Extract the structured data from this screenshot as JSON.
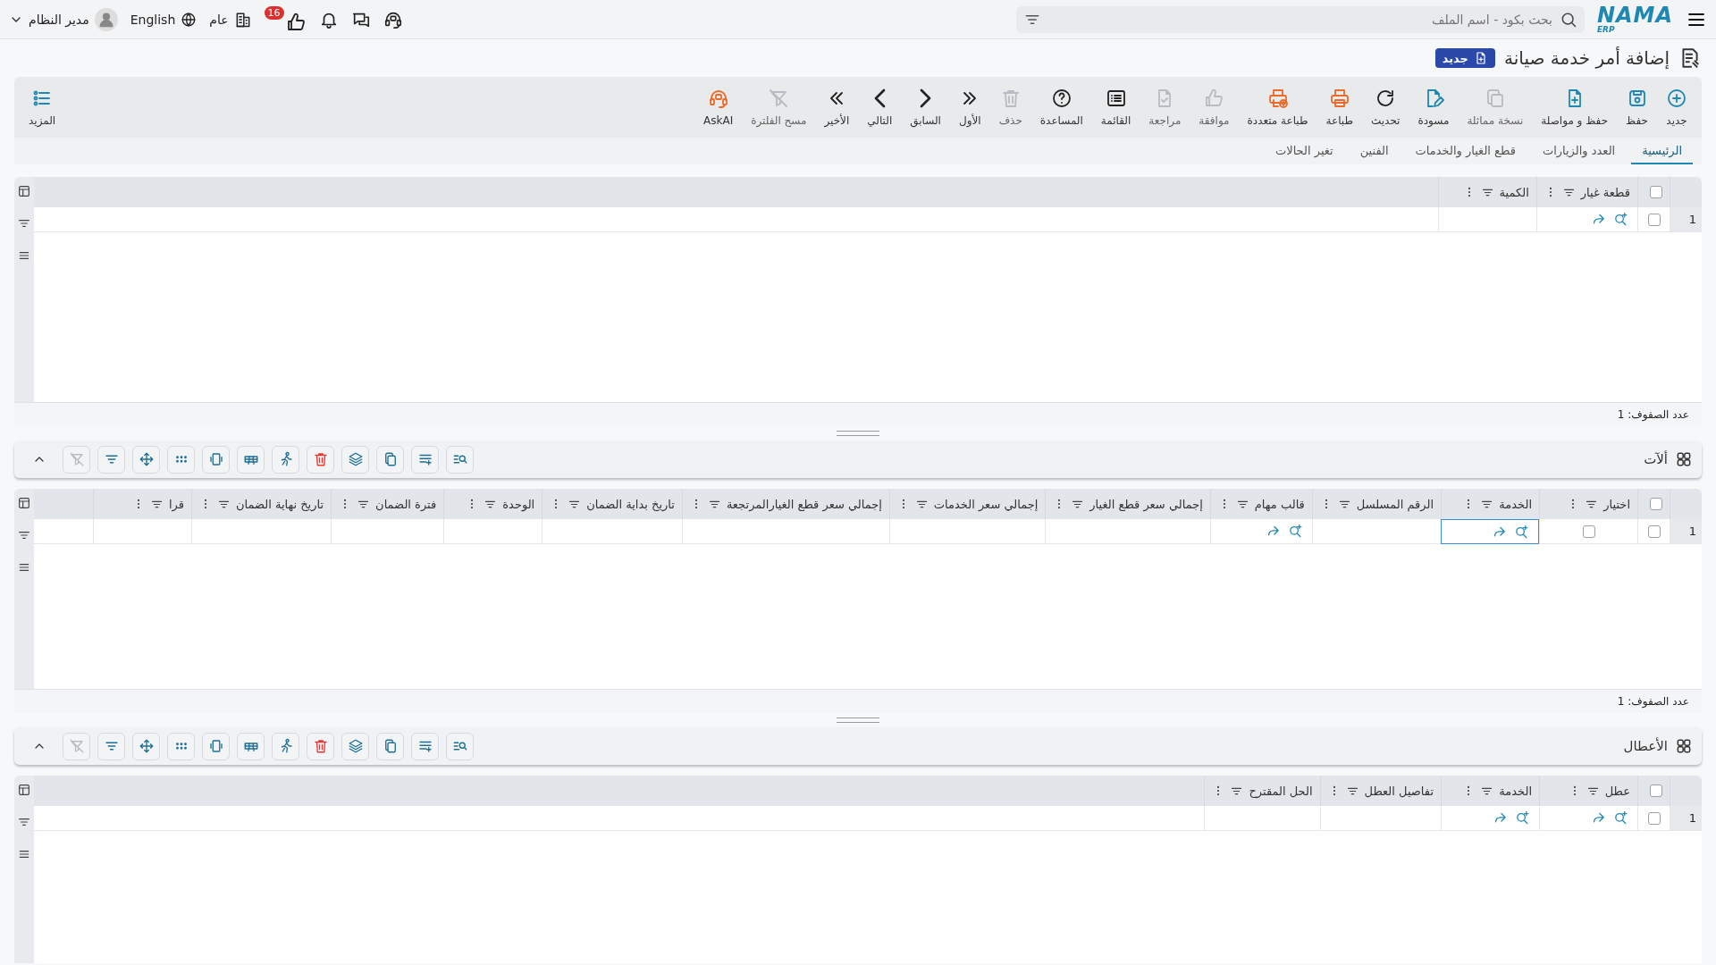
{
  "topbar": {
    "logo": "NAMA",
    "logo_sub": "ERP",
    "search": {
      "placeholder": "بحث بكود - اسم الملف"
    },
    "notifications_badge": "16",
    "branch": "عام",
    "language": "English",
    "user": "مدير النظام"
  },
  "page": {
    "title": "إضافة أمر خدمة صيانة",
    "status": "جديد"
  },
  "toolbar": {
    "buttons": [
      {
        "kind": "new",
        "label": "جديد",
        "disabled": false
      },
      {
        "kind": "save",
        "label": "حفظ",
        "disabled": false
      },
      {
        "kind": "save_continue",
        "label": "حفظ و مواصلة",
        "disabled": false
      },
      {
        "kind": "duplicate",
        "label": "نسخة مماثلة",
        "disabled": true
      },
      {
        "kind": "draft",
        "label": "مسودة",
        "disabled": false
      },
      {
        "kind": "refresh",
        "label": "تحديث",
        "disabled": false
      },
      {
        "kind": "print",
        "label": "طباعة",
        "disabled": false
      },
      {
        "kind": "print_multi",
        "label": "طباعة متعددة",
        "disabled": false
      },
      {
        "kind": "approve",
        "label": "موافقة",
        "disabled": true
      },
      {
        "kind": "review",
        "label": "مراجعة",
        "disabled": true
      },
      {
        "kind": "list",
        "label": "القائمة",
        "disabled": false
      },
      {
        "kind": "help",
        "label": "المساعدة",
        "disabled": false
      },
      {
        "kind": "delete",
        "label": "حذف",
        "disabled": true
      },
      {
        "kind": "first",
        "label": "الأول",
        "disabled": false
      },
      {
        "kind": "prev",
        "label": "السابق",
        "disabled": false
      },
      {
        "kind": "next",
        "label": "التالي",
        "disabled": false
      },
      {
        "kind": "last",
        "label": "الأخير",
        "disabled": false
      },
      {
        "kind": "clear_filter",
        "label": "مسح الفلترة",
        "disabled": true
      },
      {
        "kind": "ask_ai",
        "label": "AskAI",
        "disabled": false
      }
    ],
    "more": {
      "label": "المزيد"
    }
  },
  "tabs": [
    {
      "label": "الرئيسية",
      "selected": true
    },
    {
      "label": "العدد والزيارات",
      "selected": false
    },
    {
      "label": "قطع الغيار والخدمات",
      "selected": false
    },
    {
      "label": "الفنين",
      "selected": false
    },
    {
      "label": "تغير الحالات",
      "selected": false
    }
  ],
  "sections": [
    {
      "grid": {
        "select_all": false,
        "columns": [
          {
            "label": "قطعة غيار"
          },
          {
            "label": "الكمية"
          }
        ],
        "rows": [
          {
            "number": "1",
            "checked": false,
            "cells": [
              {
                "kind": "lookup",
                "focused": false
              },
              {
                "kind": "empty",
                "focused": false
              }
            ]
          }
        ],
        "row_count": "عدد الصفوف: 1"
      }
    },
    {
      "title": "ألآت",
      "expanded": true,
      "tools": [
        {
          "kind": "search_list",
          "disabled": false
        },
        {
          "kind": "add_row",
          "disabled": false
        },
        {
          "kind": "copy",
          "disabled": false
        },
        {
          "kind": "layers",
          "disabled": false
        },
        {
          "kind": "delete",
          "disabled": false
        },
        {
          "kind": "run",
          "disabled": false
        },
        {
          "kind": "table",
          "disabled": false
        },
        {
          "kind": "fit",
          "disabled": false
        },
        {
          "kind": "dots",
          "disabled": false
        },
        {
          "kind": "move",
          "disabled": false
        },
        {
          "kind": "filter",
          "disabled": false
        },
        {
          "kind": "filter_off",
          "disabled": true
        }
      ],
      "grid": {
        "select_all": false,
        "columns": [
          {
            "label": "اختيار"
          },
          {
            "label": "الخدمة"
          },
          {
            "label": "الرقم المسلسل"
          },
          {
            "label": "قالب مهام"
          },
          {
            "label": "إجمالي سعر قطع الغيار"
          },
          {
            "label": "إجمالي سعر الخدمات"
          },
          {
            "label": "إجمالي سعر قطع الغيارالمرتجعة"
          },
          {
            "label": "تاريخ بداية الضمان"
          },
          {
            "label": "الوحدة"
          },
          {
            "label": "فترة الضمان"
          },
          {
            "label": "تاريخ نهاية الضمان"
          },
          {
            "label": "قرا"
          }
        ],
        "rows": [
          {
            "number": "1",
            "checked": false,
            "cells": [
              {
                "kind": "checkbox",
                "checked": false,
                "focused": false
              },
              {
                "kind": "lookup",
                "focused": true
              },
              {
                "kind": "empty",
                "focused": false
              },
              {
                "kind": "lookup",
                "focused": false
              },
              {
                "kind": "empty",
                "focused": false
              },
              {
                "kind": "empty",
                "focused": false
              },
              {
                "kind": "empty",
                "focused": false
              },
              {
                "kind": "empty",
                "focused": false
              },
              {
                "kind": "empty",
                "focused": false
              },
              {
                "kind": "empty",
                "focused": false
              },
              {
                "kind": "empty",
                "focused": false
              },
              {
                "kind": "empty",
                "focused": false
              }
            ]
          }
        ],
        "row_count": "عدد الصفوف: 1"
      }
    },
    {
      "title": "الأعطال",
      "expanded": true,
      "tools": [
        {
          "kind": "search_list",
          "disabled": false
        },
        {
          "kind": "add_row",
          "disabled": false
        },
        {
          "kind": "copy",
          "disabled": false
        },
        {
          "kind": "layers",
          "disabled": false
        },
        {
          "kind": "delete",
          "disabled": false
        },
        {
          "kind": "run",
          "disabled": false
        },
        {
          "kind": "table",
          "disabled": false
        },
        {
          "kind": "fit",
          "disabled": false
        },
        {
          "kind": "dots",
          "disabled": false
        },
        {
          "kind": "move",
          "disabled": false
        },
        {
          "kind": "filter",
          "disabled": false
        },
        {
          "kind": "filter_off",
          "disabled": true
        }
      ],
      "grid": {
        "select_all": false,
        "columns": [
          {
            "label": "عطل"
          },
          {
            "label": "الخدمة"
          },
          {
            "label": "تفاصيل العطل"
          },
          {
            "label": "الحل المقترح"
          }
        ],
        "rows": [
          {
            "number": "1",
            "checked": false,
            "cells": [
              {
                "kind": "lookup",
                "focused": false
              },
              {
                "kind": "lookup",
                "focused": false
              },
              {
                "kind": "empty",
                "focused": false
              },
              {
                "kind": "empty",
                "focused": false
              }
            ]
          }
        ]
      }
    }
  ]
}
